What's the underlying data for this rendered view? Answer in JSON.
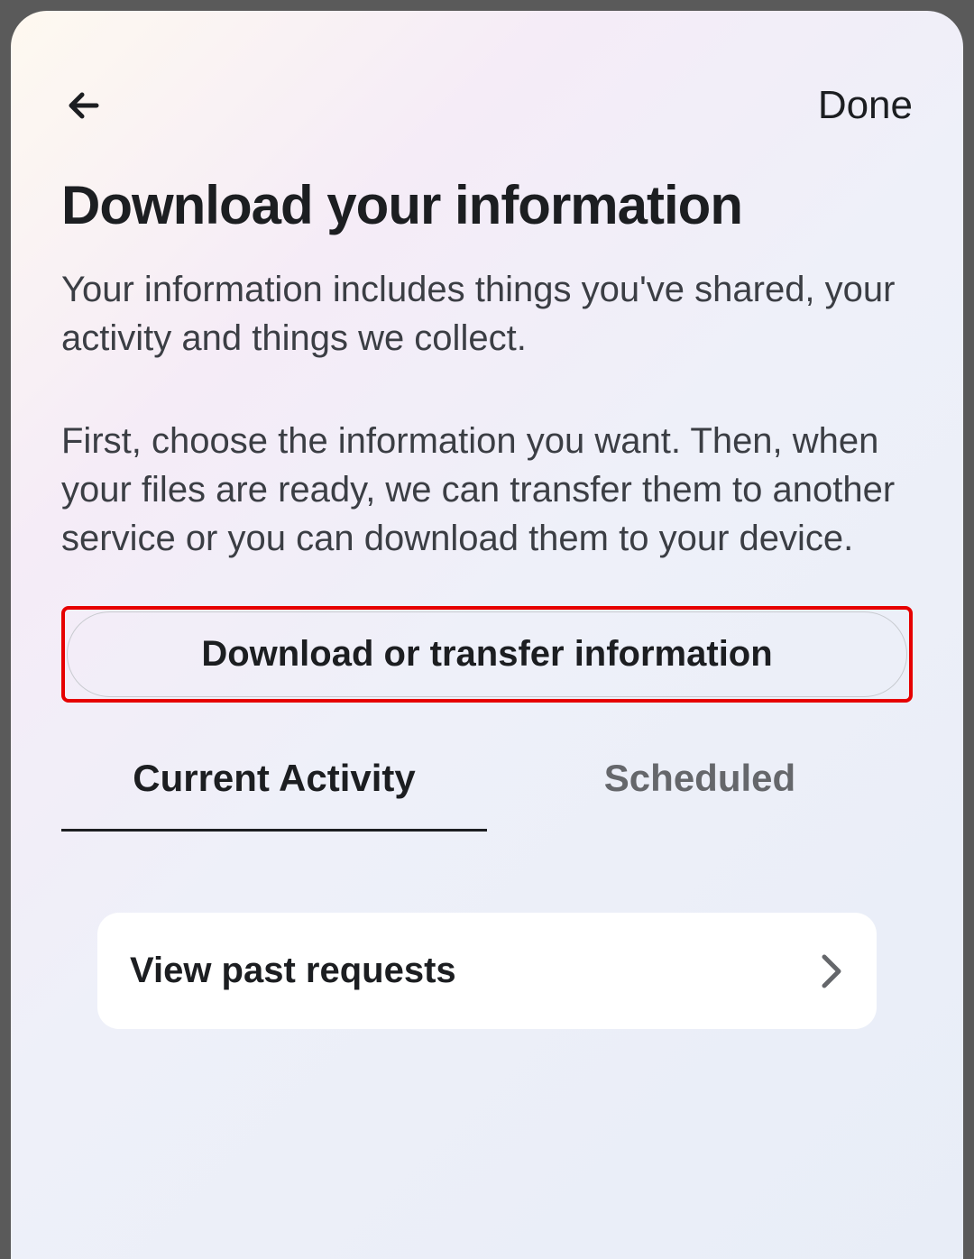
{
  "header": {
    "done_label": "Done"
  },
  "page": {
    "title": "Download your information",
    "description1": "Your information includes things you've shared, your activity and things we collect.",
    "description2": "First, choose the information you want. Then, when your files are ready, we can transfer them to another service or you can download them to your device."
  },
  "primary_action": {
    "label": "Download or transfer information"
  },
  "tabs": [
    {
      "label": "Current Activity",
      "active": true
    },
    {
      "label": "Scheduled",
      "active": false
    }
  ],
  "list": {
    "past_requests_label": "View past requests"
  }
}
